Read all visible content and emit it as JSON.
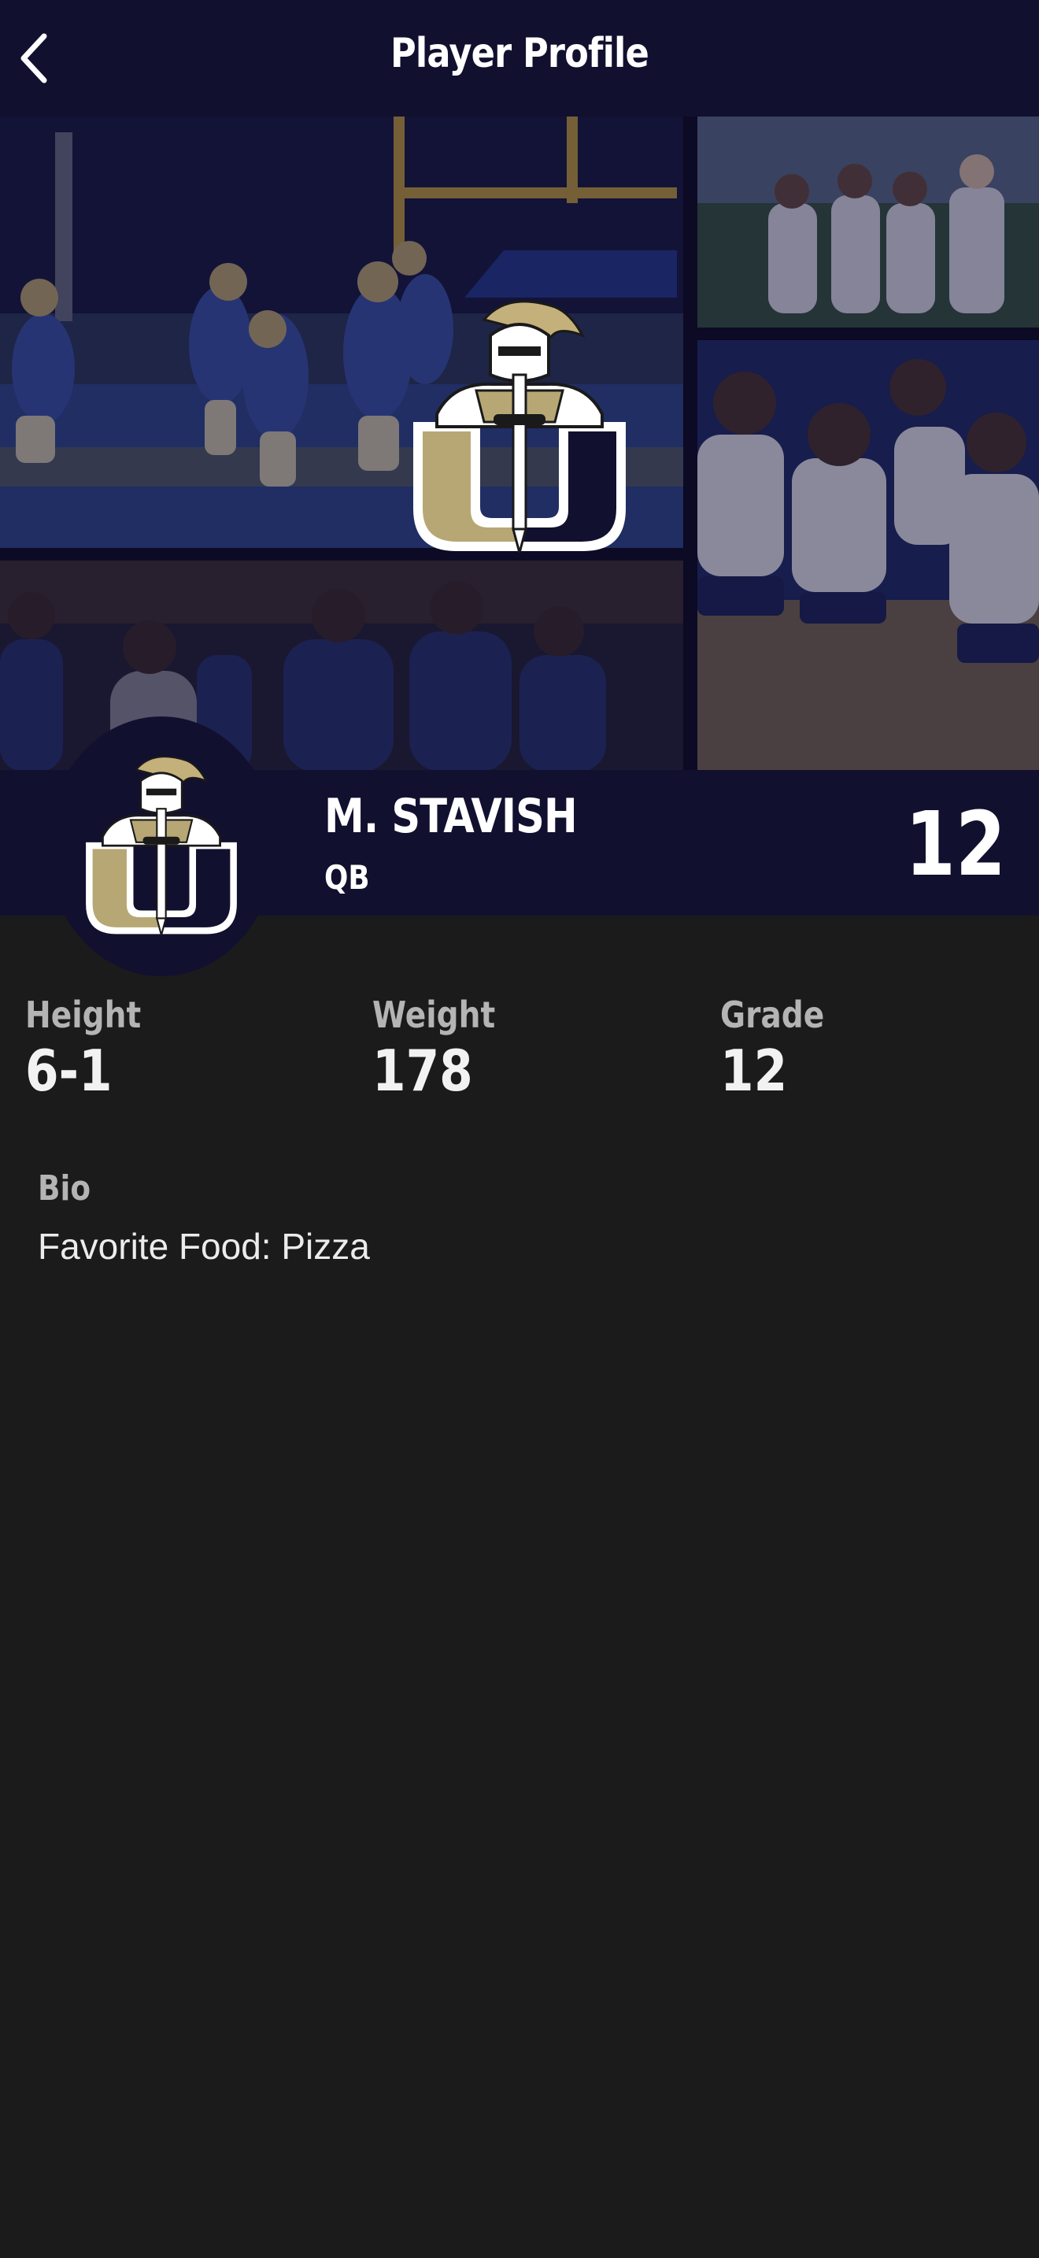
{
  "header": {
    "title": "Player Profile",
    "back_icon": "chevron-left-icon"
  },
  "banner": {
    "photos": [
      "football-celebration-photo",
      "volleyball-team-photo",
      "volleyball-huddle-photo",
      "basketball-huddle-photo"
    ],
    "logo_icon": "knight-u-logo"
  },
  "player": {
    "name": "M. STAVISH",
    "position": "QB",
    "number": "12"
  },
  "stats": [
    {
      "label": "Height",
      "value": "6-1"
    },
    {
      "label": "Weight",
      "value": "178"
    },
    {
      "label": "Grade",
      "value": "12"
    }
  ],
  "bio": {
    "label": "Bio",
    "text": "Favorite Food: Pizza"
  },
  "colors": {
    "navy": "#12102f",
    "background": "#1b1b1b",
    "gold": "#b7a774",
    "white": "#ffffff"
  }
}
